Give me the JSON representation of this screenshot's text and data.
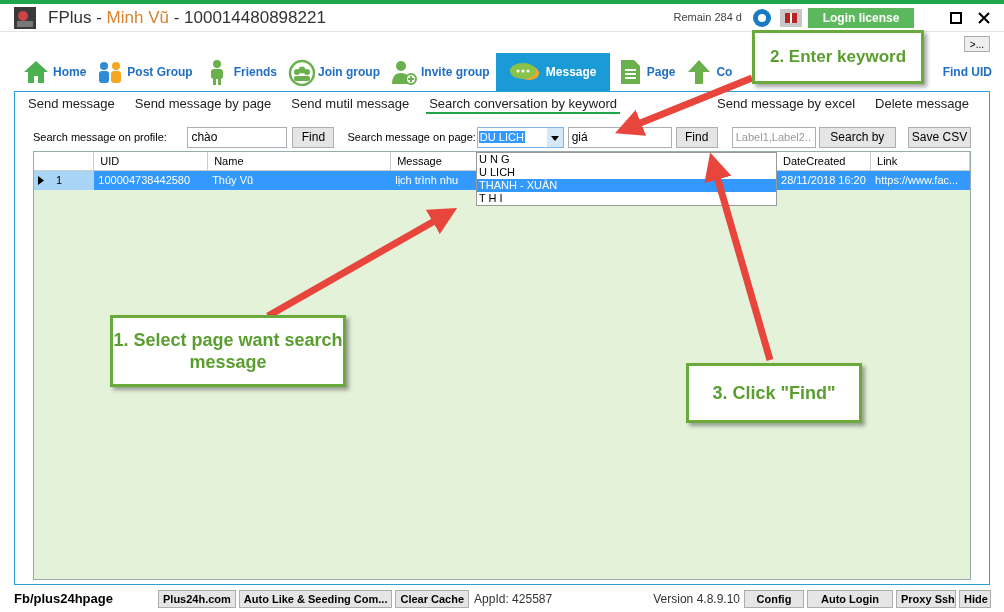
{
  "window": {
    "title_prefix": "FPlus - ",
    "user": "Minh Vũ",
    "title_suffix": " - 100014480898221",
    "remain": "Remain 284 d",
    "login_button": "Login license"
  },
  "more_button": ">...",
  "nav": [
    {
      "label": "Home",
      "kind": "house",
      "selected": false
    },
    {
      "label": "Post Group",
      "kind": "people",
      "selected": false
    },
    {
      "label": "Friends",
      "kind": "person",
      "selected": false
    },
    {
      "label": "Join group",
      "kind": "group",
      "selected": false
    },
    {
      "label": "Invite group",
      "kind": "invite",
      "selected": false
    },
    {
      "label": "Message",
      "kind": "chat",
      "selected": true
    },
    {
      "label": "Page",
      "kind": "document",
      "selected": false
    },
    {
      "label": "Co",
      "kind": "arrow",
      "selected": false
    },
    {
      "label": "Find UID",
      "kind": "plain",
      "selected": false
    }
  ],
  "subtabs": [
    {
      "label": "Send message",
      "selected": false
    },
    {
      "label": "Send message by page",
      "selected": false
    },
    {
      "label": "Send mutil message",
      "selected": false
    },
    {
      "label": "Search conversation by keyword",
      "selected": true
    },
    {
      "label": "Send message by excel",
      "selected": false
    },
    {
      "label": "Delete message",
      "selected": false
    }
  ],
  "search": {
    "profile_label": "Search message on profile:",
    "profile_value": "chào",
    "find_profile": "Find",
    "page_label": "Search message on page:",
    "page_value": "DU LICH",
    "keyword": "giá",
    "find_page": "Find",
    "labels_placeholder": "Label1,Label2...",
    "search_by": "Search by",
    "save_csv": "Save CSV"
  },
  "dropdown": [
    {
      "label": "U N G",
      "selected": false
    },
    {
      "label": "U LICH",
      "selected": false
    },
    {
      "label": "THANH - XUÂN",
      "selected": true
    },
    {
      "label": "T H I",
      "selected": false
    }
  ],
  "table": {
    "columns": [
      "UID",
      "Name",
      "Message",
      "DateCreated",
      "Link"
    ],
    "rows": [
      {
        "index": "1",
        "selected": true,
        "cells": [
          "100004738442580",
          "Thúy Vũ",
          "lịch trình nhu",
          "28/11/2018 16:20",
          "https://www.fac..."
        ]
      }
    ]
  },
  "callouts": [
    {
      "text": "1. Select page want search message"
    },
    {
      "text": "2. Enter keyword"
    },
    {
      "text": "3. Click \"Find\""
    }
  ],
  "status_bar": {
    "page": "Fb/plus24hpage",
    "buttons_left": [
      "Plus24h.com",
      "Auto Like & Seeding Com...",
      "Clear Cache"
    ],
    "app_id": "AppId: 425587",
    "version": "Version 4.8.9.10",
    "buttons_right": [
      "Config",
      "Auto Login",
      "Proxy Ssh",
      "Hide"
    ]
  }
}
